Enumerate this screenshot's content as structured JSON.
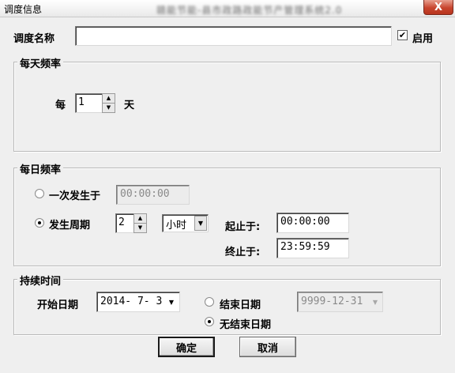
{
  "window": {
    "title": "调度信息",
    "close_label": "X",
    "blurred_caption": "赣能节能-县市政路政能节产管理系统2.0"
  },
  "schedule_name": {
    "label": "调度名称",
    "value": "",
    "enabled_label": "启用",
    "enabled": true,
    "check_mark": "✔"
  },
  "daily_frequency": {
    "title": "每天频率",
    "every_label": "每",
    "days_value": "1",
    "unit_label": "天"
  },
  "daily_occurrence": {
    "title": "每日频率",
    "once_label": "一次发生于",
    "once_time": "00:00:00",
    "once_selected": false,
    "periodic_label": "发生周期",
    "periodic_selected": true,
    "period_value": "2",
    "period_unit": "小时",
    "start_label": "起止于:",
    "start_time": "00:00:00",
    "end_label": "终止于:",
    "end_time": "23:59:59"
  },
  "duration": {
    "title": "持续时间",
    "start_date_label": "开始日期",
    "start_date": "2014- 7- 3",
    "end_date_label": "结束日期",
    "end_date": "9999-12-31",
    "end_date_selected": false,
    "no_end_label": "无结束日期",
    "no_end_selected": true
  },
  "actions": {
    "ok_label": "确定",
    "cancel_label": "取消"
  },
  "icons": {
    "spin_up": "▲",
    "spin_down": "▼",
    "dropdown": "▼"
  }
}
